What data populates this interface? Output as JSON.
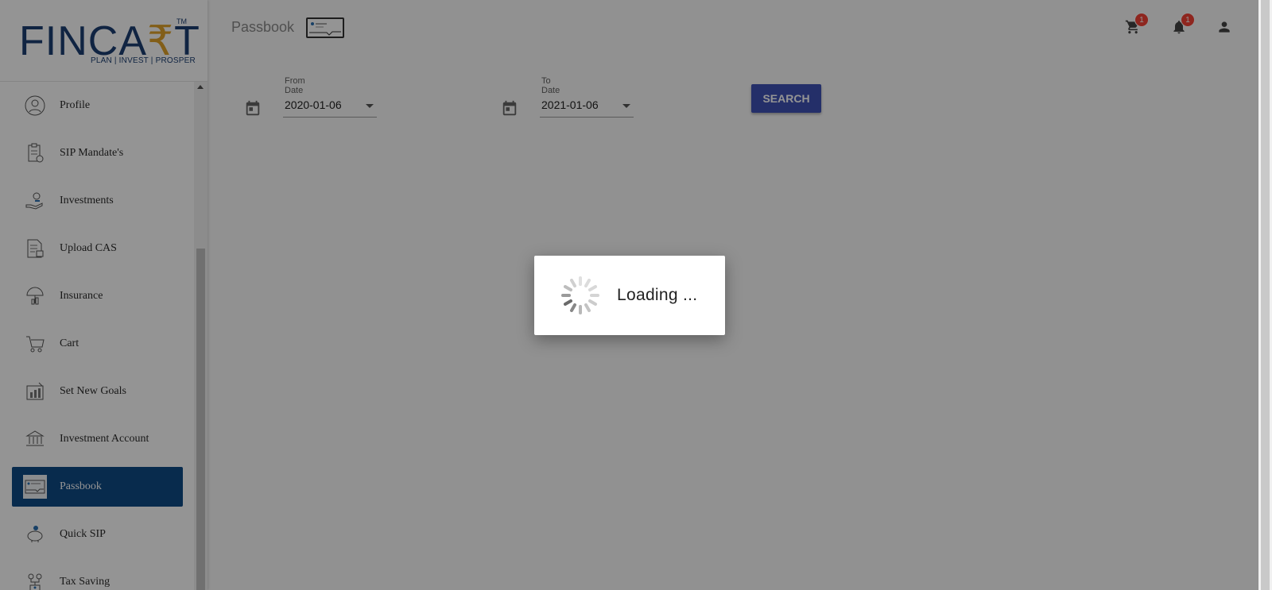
{
  "logo": {
    "word_left": "FINCA",
    "rupee": "₹",
    "word_right": "T",
    "tm": "TM",
    "tagline": "PLAN | INVEST | PROSPER"
  },
  "sidebar": {
    "items": [
      {
        "label": "Profile",
        "icon": "profile-icon"
      },
      {
        "label": "SIP Mandate's",
        "icon": "clipboard-icon"
      },
      {
        "label": "Investments",
        "icon": "investment-hand-icon"
      },
      {
        "label": "Upload CAS",
        "icon": "document-upload-icon"
      },
      {
        "label": "Insurance",
        "icon": "umbrella-icon"
      },
      {
        "label": "Cart",
        "icon": "cart-icon"
      },
      {
        "label": "Set New Goals",
        "icon": "goals-chart-icon"
      },
      {
        "label": "Investment Account",
        "icon": "bank-icon"
      },
      {
        "label": "Passbook",
        "icon": "passbook-card-icon",
        "active": true
      },
      {
        "label": "Quick SIP",
        "icon": "piggy-bank-icon"
      },
      {
        "label": "Tax Saving",
        "icon": "tax-tree-icon"
      }
    ]
  },
  "header": {
    "title": "Passbook",
    "cart_badge": "1",
    "notification_badge": "1"
  },
  "filters": {
    "from_label": "From Date",
    "from_value": "2020-01-06",
    "to_label": "To Date",
    "to_value": "2021-01-06",
    "search_label": "SEARCH"
  },
  "loading": {
    "text": "Loading ..."
  },
  "colors": {
    "brand_blue": "#0e4a86",
    "logo_blue": "#1d3e72",
    "logo_gold": "#e0a22a",
    "button": "#3f51b5",
    "badge": "#f44336"
  }
}
